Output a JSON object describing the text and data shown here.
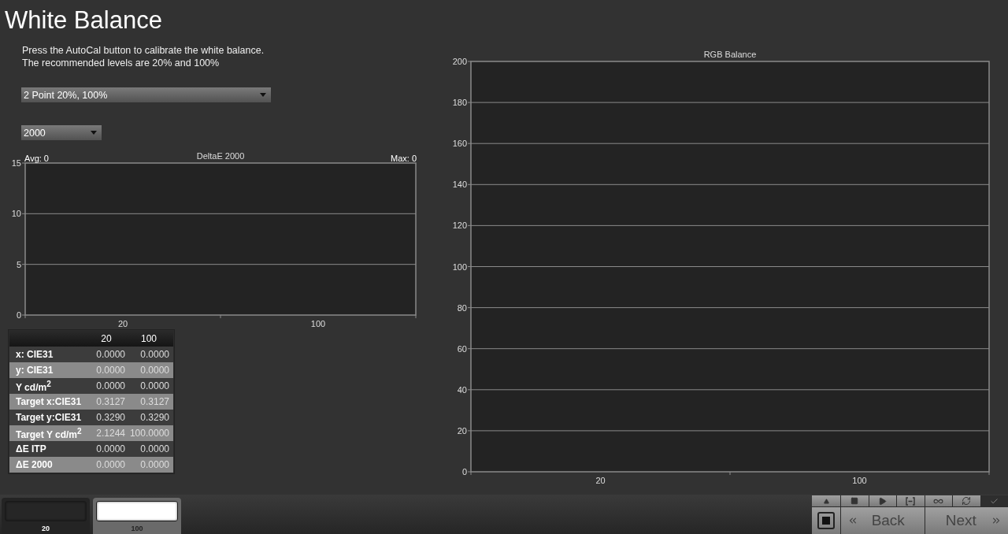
{
  "title": "White Balance",
  "instructions": [
    "Press the AutoCal button to calibrate the white balance.",
    "The recommended levels are 20% and 100%"
  ],
  "mode_select": {
    "value": "2 Point 20%, 100%"
  },
  "delta_select": {
    "value": "2000"
  },
  "delta_chart": {
    "avg": "Avg: 0",
    "max": "Max: 0",
    "chart_data": {
      "type": "bar",
      "title": "DeltaE 2000",
      "categories": [
        "20",
        "100"
      ],
      "ylim": [
        0,
        15
      ],
      "yticks": [
        0,
        5,
        10,
        15
      ],
      "grid": true
    }
  },
  "table": {
    "columns": [
      "20",
      "100"
    ],
    "rows": [
      {
        "label": "x: CIE31",
        "values": [
          "0.0000",
          "0.0000"
        ]
      },
      {
        "label": "y: CIE31",
        "values": [
          "0.0000",
          "0.0000"
        ]
      },
      {
        "label": "Y cd/m$^{2}$",
        "values": [
          "0.0000",
          "0.0000"
        ]
      },
      {
        "label": "Target x:CIE31",
        "values": [
          "0.3127",
          "0.3127"
        ]
      },
      {
        "label": "Target y:CIE31",
        "values": [
          "0.3290",
          "0.3290"
        ]
      },
      {
        "label": "Target Y cd/m$^{2}$",
        "values": [
          "2.1244",
          "100.0000"
        ]
      },
      {
        "label": "ΔE ITP",
        "values": [
          "0.0000",
          "0.0000"
        ]
      },
      {
        "label": "ΔE 2000",
        "values": [
          "0.0000",
          "0.0000"
        ]
      }
    ]
  },
  "rgb_chart": {
    "chart_data": {
      "type": "bar",
      "title": "RGB Balance",
      "categories": [
        "20",
        "100"
      ],
      "ylim": [
        0,
        200
      ],
      "yticks": [
        0,
        20,
        40,
        60,
        80,
        100,
        120,
        140,
        160,
        180,
        200
      ],
      "grid": true
    }
  },
  "patches": [
    {
      "label": "20",
      "color": "#262626",
      "selected": false
    },
    {
      "label": "100",
      "color": "#ffffff",
      "selected": true
    }
  ],
  "nav": {
    "back": "Back",
    "next": "Next"
  }
}
